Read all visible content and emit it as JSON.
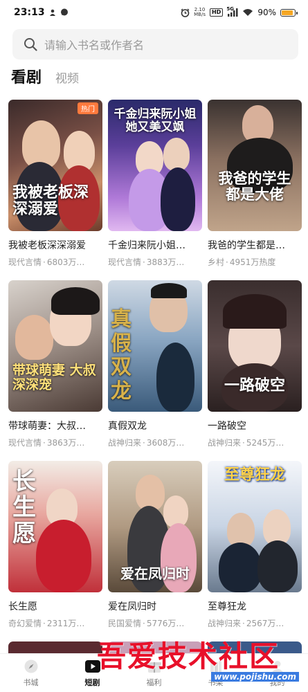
{
  "status_bar": {
    "time": "23:13",
    "net_speed_value": "2.10",
    "net_speed_unit": "MB/s",
    "hd": "HD",
    "signal_gen": "5G",
    "battery": "90%",
    "battery_level": 0.9
  },
  "search": {
    "placeholder": "请输入书名或作者名"
  },
  "tabs": {
    "active": "看剧",
    "other": "视频"
  },
  "cards": [
    {
      "title": "我被老板深深溺爱",
      "poster_text": "我被老板深深溺爱",
      "badge": "热门",
      "genre": "现代言情",
      "heat": "6803万…"
    },
    {
      "title": "千金归来阮小姐…",
      "poster_text": "千金归来阮小姐 她又美又飒",
      "genre": "现代言情",
      "heat": "3883万…"
    },
    {
      "title": "我爸的学生都是…",
      "poster_text": "我爸的学生都是大佬",
      "genre": "乡村",
      "heat": "4951万热度"
    },
    {
      "title": "带球萌妻：大叔…",
      "poster_text": "带球萌妻 大叔深深宠",
      "genre": "现代言情",
      "heat": "3863万…"
    },
    {
      "title": "真假双龙",
      "poster_text": "真假双龙",
      "genre": "战神归来",
      "heat": "3608万…"
    },
    {
      "title": "一路破空",
      "poster_text": "一路破空",
      "genre": "战神归来",
      "heat": "5245万…"
    },
    {
      "title": "长生愿",
      "poster_text": "长生愿",
      "genre": "奇幻爱情",
      "heat": "2311万…"
    },
    {
      "title": "爱在凤归时",
      "poster_text": "爱在凤归时",
      "genre": "民国爱情",
      "heat": "5776万…"
    },
    {
      "title": "至尊狂龙",
      "poster_text": "至尊狂龙",
      "genre": "战神归来",
      "heat": "2567万…"
    }
  ],
  "bottom_nav": [
    {
      "label": "书城",
      "icon": "compass-icon"
    },
    {
      "label": "短剧",
      "icon": "play-icon"
    },
    {
      "label": "福利",
      "icon": "gift-icon"
    },
    {
      "label": "书架",
      "icon": "bookshelf-icon"
    },
    {
      "label": "我的",
      "icon": "user-icon"
    }
  ],
  "watermark": {
    "text": "吾爱技术社区",
    "url": "www.pojishu.com"
  },
  "colors": {
    "accent": "#ff7a3d",
    "watermark": "#e8102a",
    "battery": "#f5a623"
  }
}
